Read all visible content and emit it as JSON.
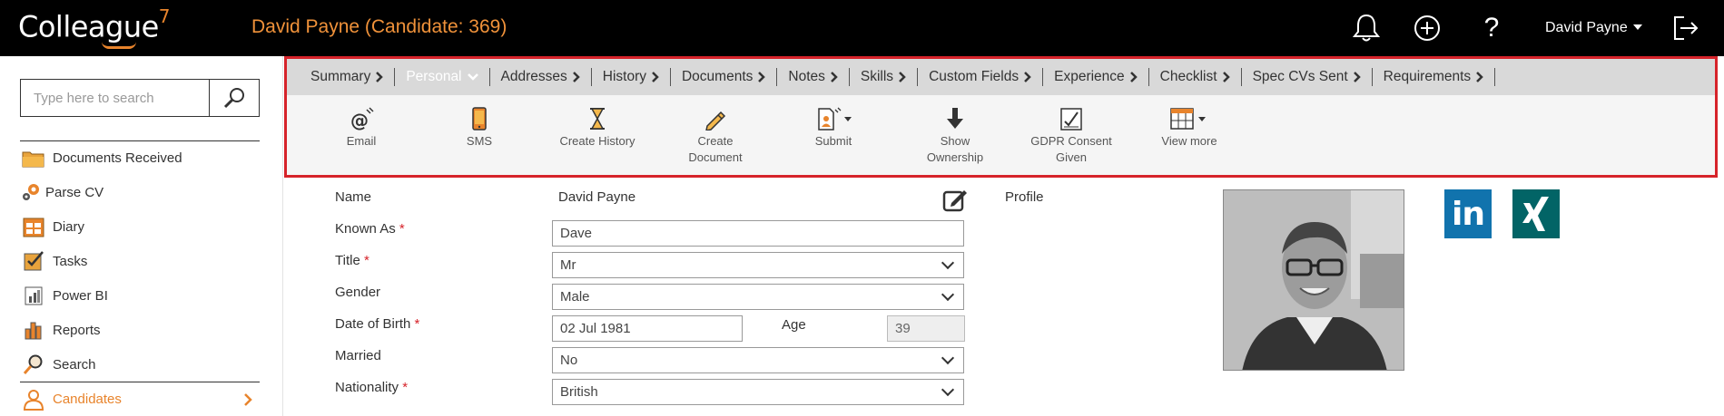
{
  "app": {
    "logo_text": "Colleague",
    "logo_version": "7",
    "page_title": "David Payne (Candidate: 369)",
    "user_name": "David Payne"
  },
  "sidebar": {
    "search_placeholder": "Type here to search",
    "items": [
      {
        "label": "Documents Received",
        "icon": "folder-icon"
      },
      {
        "label": "Parse CV",
        "icon": "gears-icon"
      },
      {
        "label": "Diary",
        "icon": "calendar-icon"
      },
      {
        "label": "Tasks",
        "icon": "tasks-icon"
      },
      {
        "label": "Power BI",
        "icon": "powerbi-icon"
      },
      {
        "label": "Reports",
        "icon": "bar-chart-icon"
      },
      {
        "label": "Search",
        "icon": "search-icon"
      },
      {
        "label": "Candidates",
        "icon": "person-icon"
      }
    ]
  },
  "tabs": [
    {
      "label": "Summary"
    },
    {
      "label": "Personal"
    },
    {
      "label": "Addresses"
    },
    {
      "label": "History"
    },
    {
      "label": "Documents"
    },
    {
      "label": "Notes"
    },
    {
      "label": "Skills"
    },
    {
      "label": "Custom Fields"
    },
    {
      "label": "Experience"
    },
    {
      "label": "Checklist"
    },
    {
      "label": "Spec CVs Sent"
    },
    {
      "label": "Requirements"
    }
  ],
  "actions": [
    {
      "line1": "Email",
      "line2": "",
      "icon": "email-icon"
    },
    {
      "line1": "SMS",
      "line2": "",
      "icon": "mobile-icon"
    },
    {
      "line1": "Create History",
      "line2": "",
      "icon": "hourglass-icon"
    },
    {
      "line1": "Create",
      "line2": "Document",
      "icon": "pencil-icon"
    },
    {
      "line1": "Submit",
      "line2": "",
      "icon": "submit-document-icon"
    },
    {
      "line1": "Show",
      "line2": "Ownership",
      "icon": "download-arrow-icon"
    },
    {
      "line1": "GDPR Consent",
      "line2": "Given",
      "icon": "consent-document-icon"
    },
    {
      "line1": "View more",
      "line2": "",
      "icon": "grid-icon"
    }
  ],
  "form": {
    "name_label": "Name",
    "name_value": "David Payne",
    "known_as_label": "Known As",
    "known_as_value": "Dave",
    "title_label": "Title",
    "title_value": "Mr",
    "gender_label": "Gender",
    "gender_value": "Male",
    "dob_label": "Date of Birth",
    "dob_value": "02 Jul 1981",
    "age_label": "Age",
    "age_value": "39",
    "married_label": "Married",
    "married_value": "No",
    "nationality_label": "Nationality",
    "nationality_value": "British",
    "required_mark": "*",
    "profile_label": "Profile"
  },
  "social": {
    "linkedin_text": "in"
  },
  "colors": {
    "accent": "#e8842c",
    "title_orange": "#f0923a",
    "highlight_red": "#d6232a",
    "linkedin_blue": "#1173ad",
    "xing_teal": "#026466"
  }
}
